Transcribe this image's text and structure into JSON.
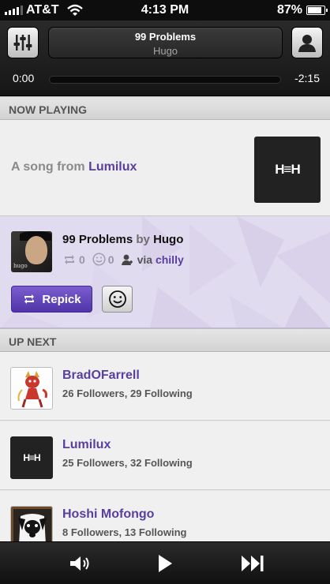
{
  "status_bar": {
    "carrier": "AT&T",
    "time": "4:13 PM",
    "battery": "87%",
    "battery_level": 0.87,
    "signal_bars": 4
  },
  "player": {
    "track_title": "99 Problems",
    "track_artist": "Hugo",
    "elapsed": "0:00",
    "remaining": "-2:15",
    "progress": 0.0
  },
  "now_playing": {
    "header": "NOW PLAYING",
    "prefix": "A song from ",
    "source": "Lumilux",
    "logo_text": "H≡H"
  },
  "current_card": {
    "song": "99 Problems",
    "by": " by ",
    "artist": "Hugo",
    "art_caption": "hugo",
    "repick_count": "0",
    "like_count": "0",
    "via": "via ",
    "via_user": "chilly",
    "repick_label": "Repick"
  },
  "up_next": {
    "header": "UP NEXT",
    "users": [
      {
        "name": "BradOFarrell",
        "stats": "26 Followers, 29 Following"
      },
      {
        "name": "Lumilux",
        "stats": "25 Followers, 32 Following",
        "logo_text": "H≡H"
      },
      {
        "name": "Hoshi Mofongo",
        "stats": "8 Followers, 13 Following"
      }
    ]
  },
  "icons": {
    "mixer": "equalizer-icon",
    "profile": "person-icon",
    "volume": "speaker-icon",
    "play": "play-icon",
    "next": "skip-next-icon"
  },
  "colors": {
    "accent": "#5a3e9e",
    "card_bg": "#e1dbef"
  }
}
